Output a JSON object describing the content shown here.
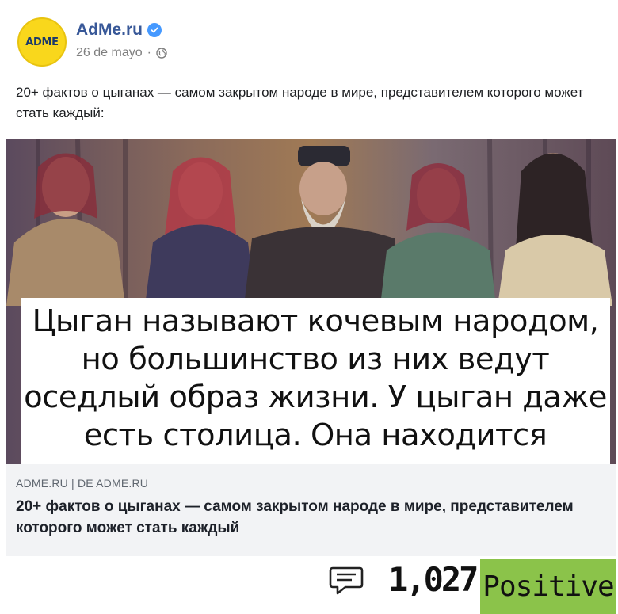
{
  "post": {
    "page_name": "AdMe.ru",
    "avatar_text": "ADME",
    "date": "26 de mayo",
    "separator": "·",
    "text": "20+ фактов о цыганах — самом закрытом народе в мире, представителем которого может стать каждый:"
  },
  "image": {
    "caption": "Цыган называют кочевым народом, но большинство из них ведут оседлый образ жизни. У цыган даже есть столица. Она находится"
  },
  "link_card": {
    "domain": "ADME.RU | DE ADME.RU",
    "title": "20+ фактов о цыганах — самом закрытом народе в мире, представителем которого может стать каждый"
  },
  "stats": {
    "comment_count": "1,027",
    "sentiment": "Positive",
    "sentiment_color": "#8bc34a"
  },
  "icons": [
    "verified-badge-icon",
    "globe-icon",
    "comment-icon"
  ]
}
